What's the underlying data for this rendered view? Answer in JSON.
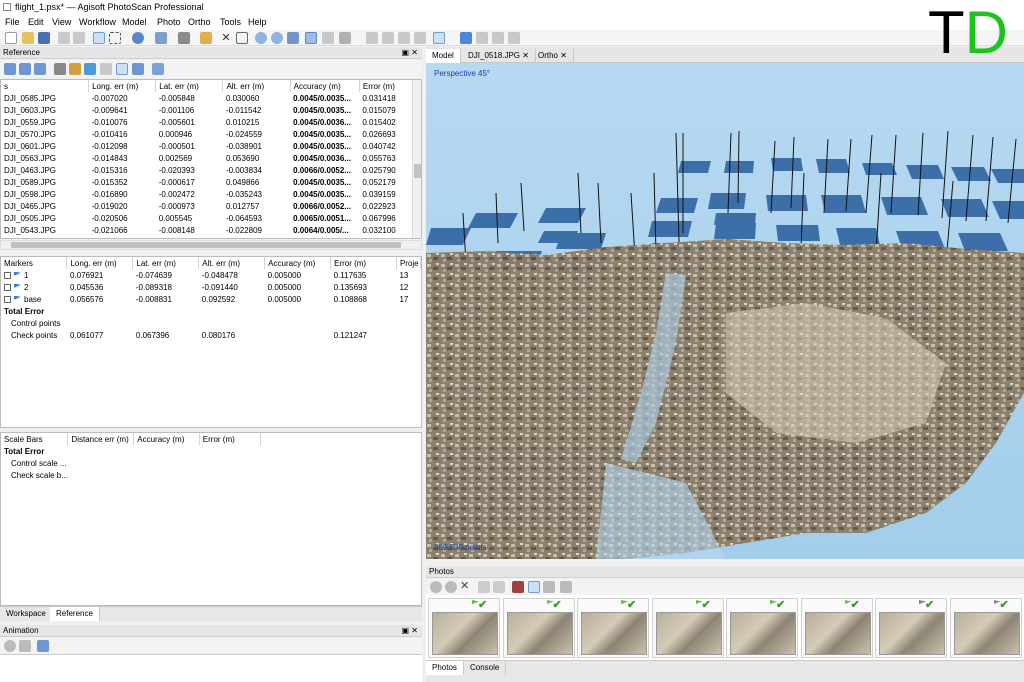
{
  "window": {
    "title": "flight_1.psx* — Agisoft PhotoScan Professional"
  },
  "menu": [
    "File",
    "Edit",
    "View",
    "Workflow",
    "Model",
    "Photo",
    "Ortho",
    "Tools",
    "Help"
  ],
  "watermark": {
    "t": "T",
    "d": "D",
    "d_color": "#1dc41d"
  },
  "reference": {
    "title": "Reference",
    "cameras": {
      "headers": [
        "s",
        "Long. err (m)",
        "Lat. err (m)",
        "Alt. err (m)",
        "Accuracy (m)",
        "Error (m)"
      ],
      "rows": [
        [
          "DJI_0585.JPG",
          "-0.007020",
          "-0.005848",
          "0.030060",
          "0.0045/0.0035...",
          "0.031418"
        ],
        [
          "DJI_0603.JPG",
          "-0.009641",
          "-0.001106",
          "-0.011542",
          "0.0045/0.0035...",
          "0.015079"
        ],
        [
          "DJI_0559.JPG",
          "-0.010076",
          "-0.005601",
          "0.010215",
          "0.0045/0.0036...",
          "0.015402"
        ],
        [
          "DJI_0570.JPG",
          "-0.010416",
          "0.000946",
          "-0.024559",
          "0.0045/0.0035...",
          "0.026693"
        ],
        [
          "DJI_0601.JPG",
          "-0.012098",
          "-0.000501",
          "-0.038901",
          "0.0045/0.0035...",
          "0.040742"
        ],
        [
          "DJI_0563.JPG",
          "-0.014843",
          "0.002569",
          "0.053690",
          "0.0045/0.0036...",
          "0.055763"
        ],
        [
          "DJI_0463.JPG",
          "-0.015316",
          "-0.020393",
          "-0.003834",
          "0.0066/0.0052...",
          "0.025790"
        ],
        [
          "DJI_0589.JPG",
          "-0.015352",
          "-0.000617",
          "0.049866",
          "0.0045/0.0035...",
          "0.052179"
        ],
        [
          "DJI_0598.JPG",
          "-0.016890",
          "-0.002472",
          "-0.035243",
          "0.0045/0.0035...",
          "0.039159"
        ],
        [
          "DJI_0465.JPG",
          "-0.019020",
          "-0.000973",
          "0.012757",
          "0.0066/0.0052...",
          "0.022923"
        ],
        [
          "DJI_0505.JPG",
          "-0.020506",
          "0.005545",
          "-0.064593",
          "0.0065/0.0051...",
          "0.067996"
        ],
        [
          "DJI_0543.JPG",
          "-0.021066",
          "-0.008148",
          "-0.022809",
          "0.0064/0.005/...",
          "0.032100"
        ]
      ]
    },
    "markers": {
      "headers": [
        "Markers",
        "Long. err (m)",
        "Lat. err (m)",
        "Alt. err (m)",
        "Accuracy (m)",
        "Error (m)",
        "Proje"
      ],
      "rows": [
        [
          "1",
          "0.076921",
          "-0.074639",
          "-0.048478",
          "0.005000",
          "0.117635",
          "13"
        ],
        [
          "2",
          "0.045536",
          "-0.089318",
          "-0.091440",
          "0.005000",
          "0.135693",
          "12"
        ],
        [
          "base",
          "0.056576",
          "-0.008831",
          "0.092592",
          "0.005000",
          "0.108868",
          "17"
        ]
      ],
      "total_label": "Total Error",
      "control_label": "Control points",
      "check_label": "Check points",
      "check_values": [
        "0.061077",
        "0.067396",
        "0.080176",
        "",
        "0.121247"
      ]
    },
    "scalebars": {
      "headers": [
        "Scale Bars",
        "Distance err (m)",
        "Accuracy (m)",
        "Error (m)"
      ],
      "total_label": "Total Error",
      "control_label": "Control scale ...",
      "check_label": "Check scale b..."
    },
    "tabs": [
      "Workspace",
      "Reference"
    ]
  },
  "animation": {
    "title": "Animation"
  },
  "view": {
    "tabs": [
      "Model",
      "DJI_0518.JPG",
      "Ortho"
    ],
    "projection": "Perspective 45°",
    "points": "389,530 points"
  },
  "photos": {
    "title": "Photos",
    "tabs": [
      "Photos",
      "Console"
    ]
  }
}
